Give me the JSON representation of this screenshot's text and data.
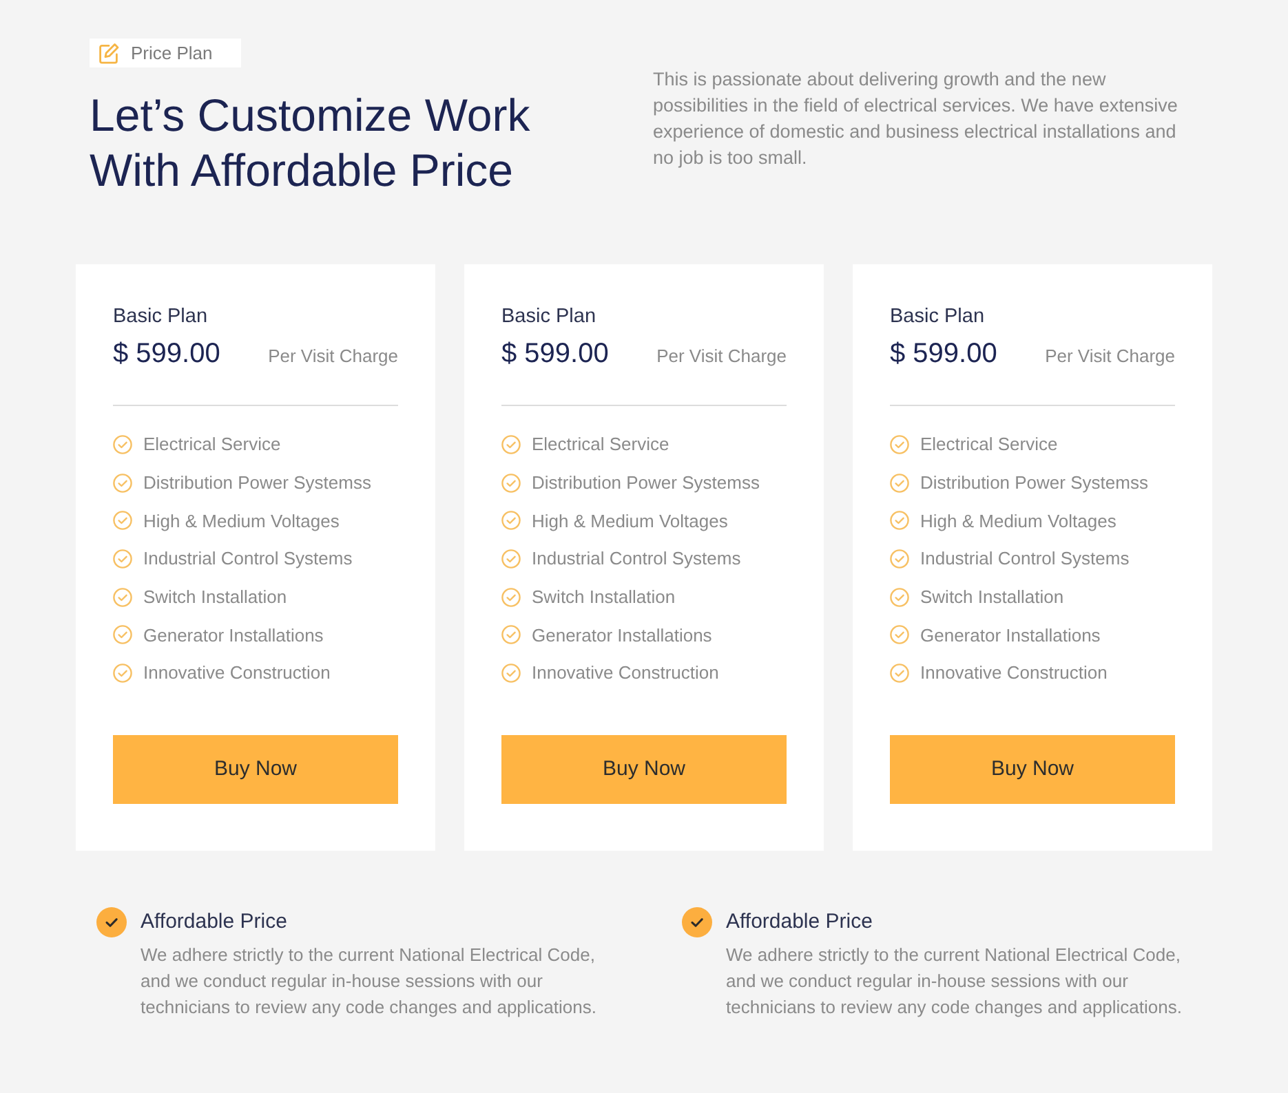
{
  "header": {
    "tag": "Price Plan",
    "title": "Let’s Customize Work With Affordable Price",
    "description": "This is passionate about delivering growth and the new possibilities in the field of electrical services. We have extensive experience of domestic and business electrical installations and no job is too small."
  },
  "plans": [
    {
      "name": "Basic Plan",
      "price": "$ 599.00",
      "price_note": "Per Visit Charge",
      "features": [
        "Electrical Service",
        "Distribution Power Systemss",
        "High & Medium Voltages",
        "Industrial Control Systems",
        "Switch Installation",
        "Generator Installations",
        "Innovative Construction"
      ],
      "button": "Buy Now"
    },
    {
      "name": "Basic Plan",
      "price": "$ 599.00",
      "price_note": "Per Visit Charge",
      "features": [
        "Electrical Service",
        "Distribution Power Systemss",
        "High & Medium Voltages",
        "Industrial Control Systems",
        "Switch Installation",
        "Generator Installations",
        "Innovative Construction"
      ],
      "button": "Buy Now"
    },
    {
      "name": "Basic Plan",
      "price": "$ 599.00",
      "price_note": "Per Visit Charge",
      "features": [
        "Electrical Service",
        "Distribution Power Systemss",
        "High & Medium Voltages",
        "Industrial Control Systems",
        "Switch Installation",
        "Generator Installations",
        "Innovative Construction"
      ],
      "button": "Buy Now"
    }
  ],
  "highlights": [
    {
      "title": "Affordable Price",
      "text": "We adhere strictly to the current National Electrical Code, and we conduct regular in-house sessions with our technicians to review any code changes and applications."
    },
    {
      "title": "Affordable Price",
      "text": "We adhere strictly to the current National Electrical Code, and we conduct regular in-house sessions with our technicians to review any code changes and applications."
    }
  ]
}
